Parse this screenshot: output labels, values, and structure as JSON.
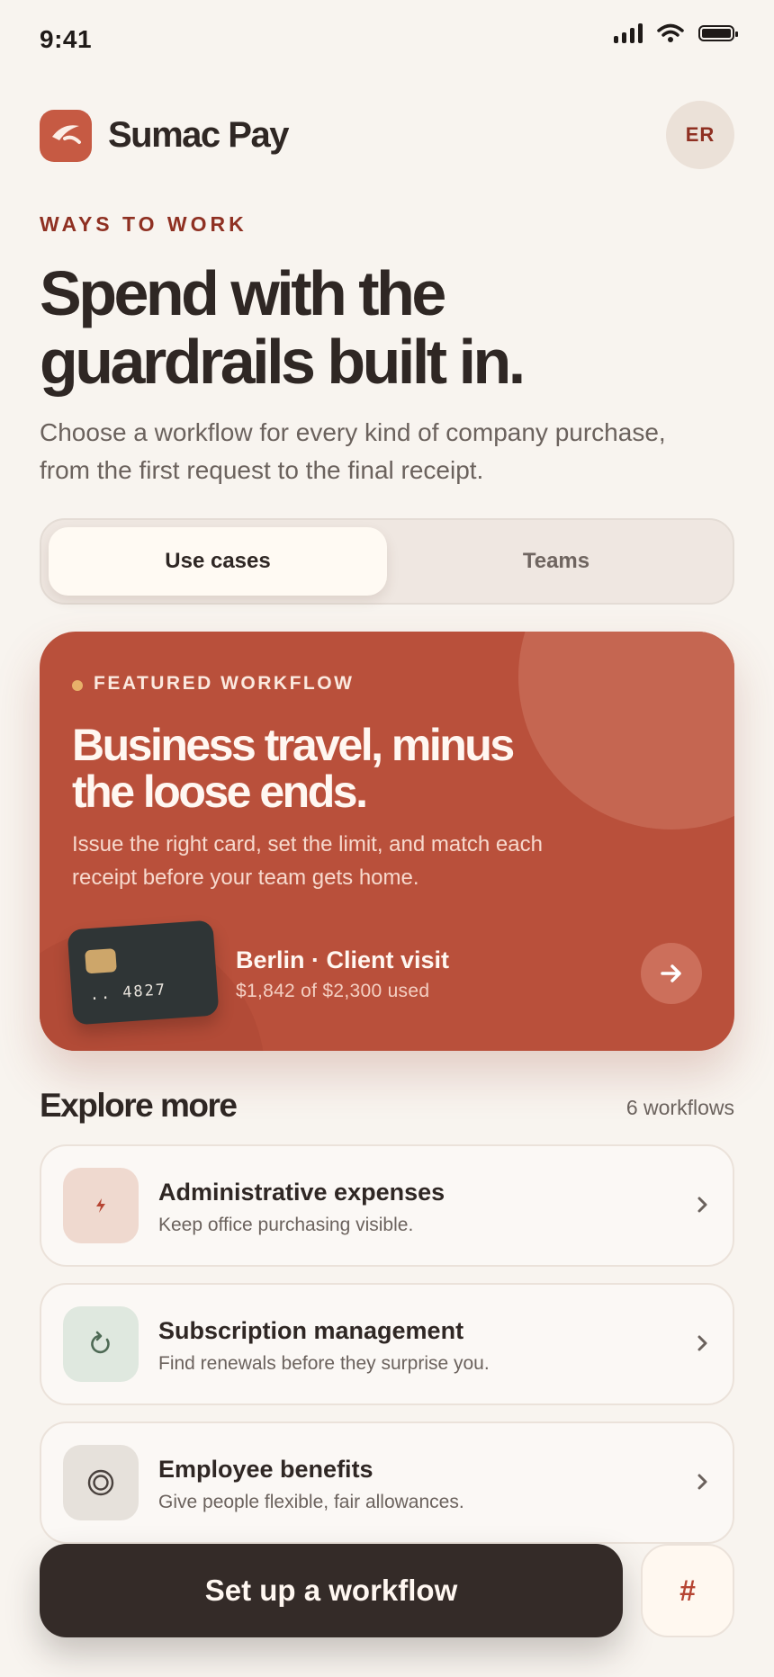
{
  "status_bar": {
    "time": "9:41"
  },
  "header": {
    "brand": "Sumac Pay",
    "avatar_initials": "ER"
  },
  "hero": {
    "eyebrow": "WAYS TO WORK",
    "headline": "Spend with the guardrails built in.",
    "subhead": "Choose a workflow for every kind of company purchase, from the first request to the final receipt."
  },
  "tabs": [
    {
      "label": "Use cases",
      "selected": true
    },
    {
      "label": "Teams",
      "selected": false
    }
  ],
  "featured": {
    "label": "FEATURED WORKFLOW",
    "title": "Business travel, minus the loose ends.",
    "description": "Issue the right card, set the limit, and match each receipt before your team gets home.",
    "card_number": ".. 4827",
    "trip_title": "Berlin · Client visit",
    "trip_usage": "$1,842 of $2,300 used",
    "spent": 1842,
    "limit": 2300,
    "accent_color": "#b9503b"
  },
  "explore": {
    "title": "Explore more",
    "count": "6 workflows",
    "items": [
      {
        "title": "Administrative expenses",
        "subtitle": "Keep office purchasing visible.",
        "icon": "bolt-icon",
        "icon_bg": "#efd9cf"
      },
      {
        "title": "Subscription management",
        "subtitle": "Find renewals before they surprise you.",
        "icon": "refresh-icon",
        "icon_bg": "#dfe8df"
      },
      {
        "title": "Employee benefits",
        "subtitle": "Give people flexible, fair allowances.",
        "icon": "target-icon",
        "icon_bg": "#e6e1db"
      }
    ]
  },
  "bottom": {
    "cta_label": "Set up a workflow",
    "hash_label": "#"
  }
}
